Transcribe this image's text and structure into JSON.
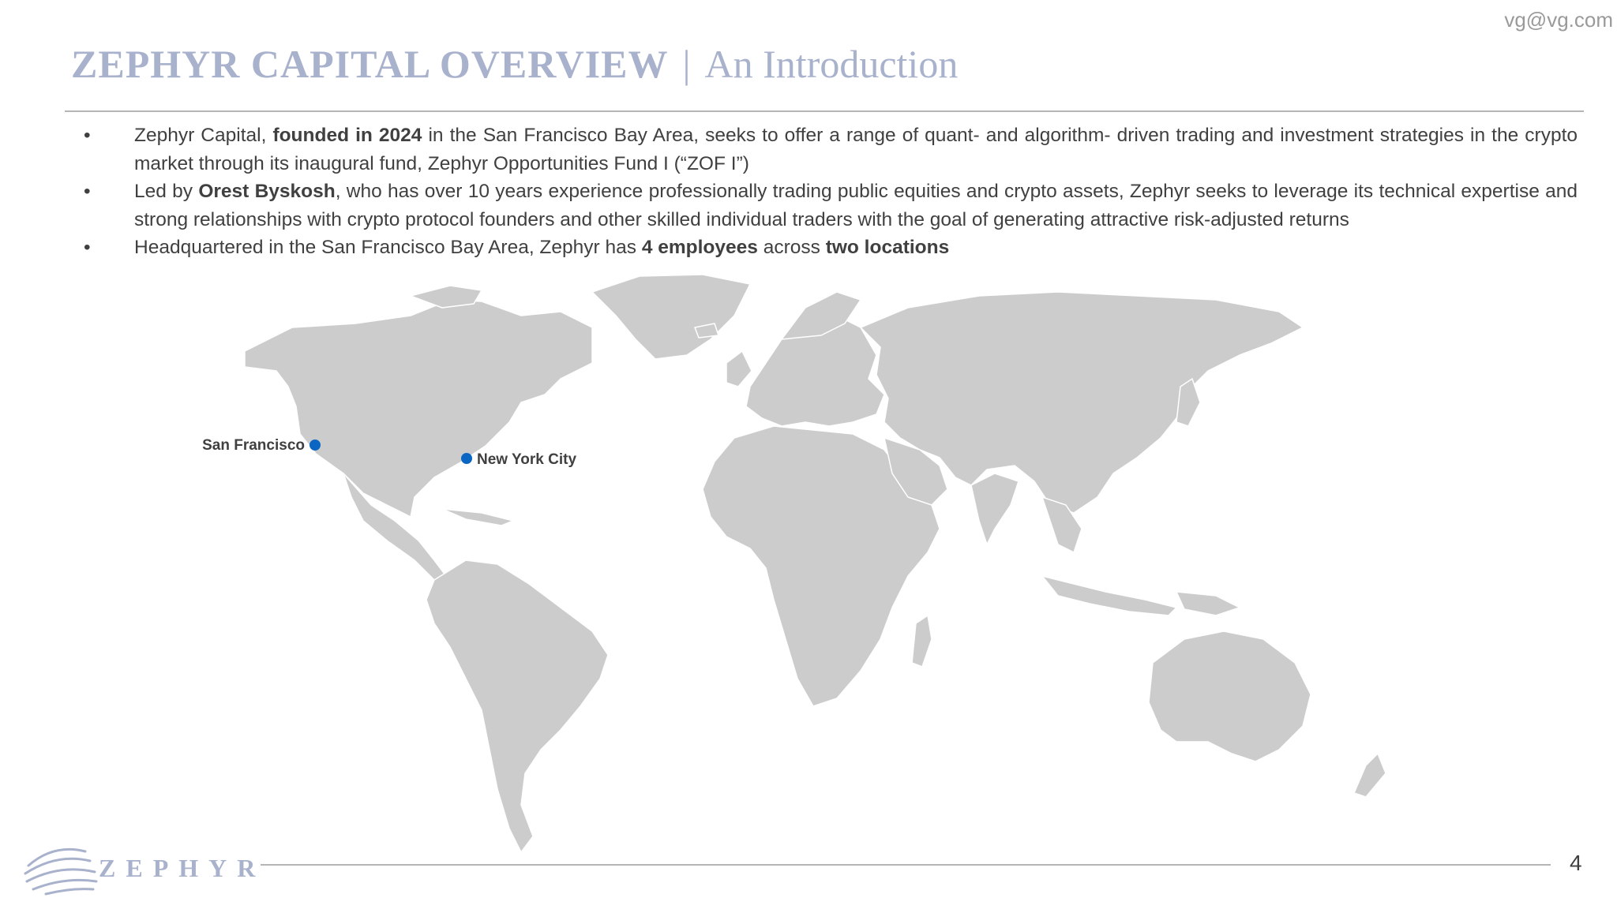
{
  "header": {
    "email": "vg@vg.com",
    "title_main": "ZEPHYR CAPITAL OVERVIEW",
    "title_separator": "|",
    "title_sub": "An Introduction"
  },
  "bullets": [
    {
      "parts": [
        {
          "text": "Zephyr Capital, ",
          "bold": false
        },
        {
          "text": "founded in 2024",
          "bold": true
        },
        {
          "text": " in the San Francisco Bay Area, seeks to offer a range of quant- and algorithm- driven trading and investment strategies in the crypto market through its inaugural fund, Zephyr Opportunities Fund I (“ZOF I”)",
          "bold": false
        }
      ]
    },
    {
      "parts": [
        {
          "text": "Led by ",
          "bold": false
        },
        {
          "text": "Orest Byskosh",
          "bold": true
        },
        {
          "text": ", who has over 10 years experience professionally trading public equities and crypto assets, Zephyr seeks to leverage its technical expertise and strong relationships with crypto protocol founders and other skilled individual traders with the goal of generating attractive risk-adjusted returns",
          "bold": false
        }
      ]
    },
    {
      "parts": [
        {
          "text": "Headquartered in the San Francisco Bay Area, Zephyr has ",
          "bold": false
        },
        {
          "text": "4 employees",
          "bold": true
        },
        {
          "text": " across ",
          "bold": false
        },
        {
          "text": "two locations",
          "bold": true
        }
      ]
    }
  ],
  "bullet_glyph": "•",
  "map": {
    "land_color": "#cccccc",
    "marker_color": "#0a66c2",
    "locations": [
      {
        "name": "San Francisco"
      },
      {
        "name": "New York City"
      }
    ]
  },
  "footer": {
    "logo_text": "ZEPHYR",
    "page_number": "4"
  },
  "colors": {
    "title": "#a9b2cc",
    "body_text": "#404040",
    "rule": "#b5b5b5"
  }
}
